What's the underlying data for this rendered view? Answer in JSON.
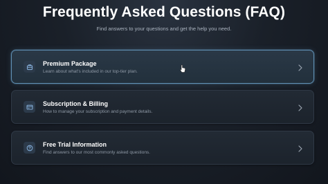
{
  "header": {
    "title": "Frequently Asked Questions (FAQ)",
    "subtitle": "Find answers to your questions and get the help you need."
  },
  "faq_items": [
    {
      "title": "Premium Package",
      "description": "Learn about what's included in our top-tier plan.",
      "icon": "package-icon",
      "active": true
    },
    {
      "title": "Subscription & Billing",
      "description": "How to manage your subscription and payment details.",
      "icon": "billing-card-icon",
      "active": false
    },
    {
      "title": "Free Trial Information",
      "description": "Find answers to our most commonly asked questions.",
      "icon": "question-circle-icon",
      "active": false
    }
  ],
  "colors": {
    "background": "#1a2029",
    "card": "#222a34",
    "active_border": "#5f8fb3",
    "icon_bg": "#2c3a4a",
    "icon_stroke": "#7fa7d0"
  }
}
